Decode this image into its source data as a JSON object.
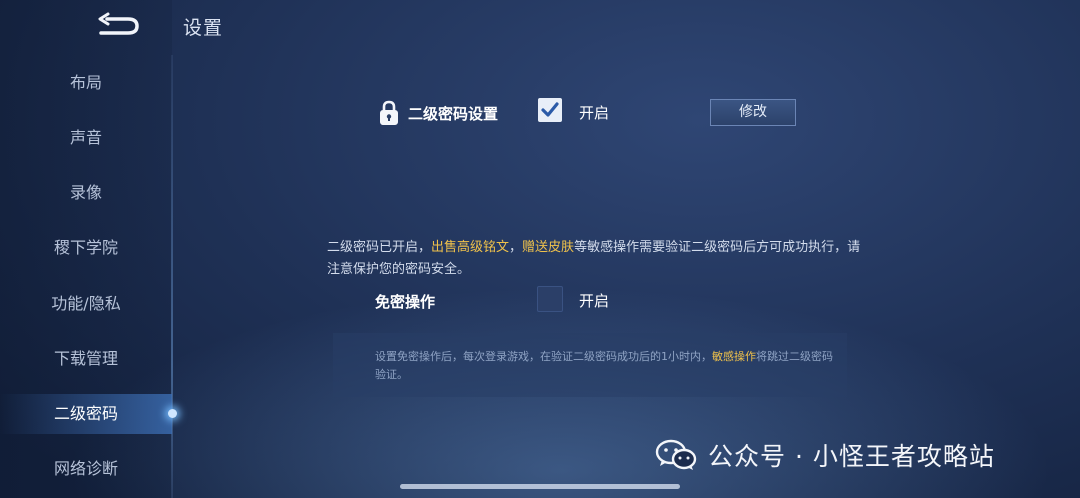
{
  "header": {
    "title": "设置",
    "back_icon": "back-arrow-icon"
  },
  "sidebar": {
    "items": [
      {
        "label": "布局",
        "active": false
      },
      {
        "label": "声音",
        "active": false
      },
      {
        "label": "录像",
        "active": false
      },
      {
        "label": "稷下学院",
        "active": false
      },
      {
        "label": "功能/隐私",
        "active": false
      },
      {
        "label": "下载管理",
        "active": false
      },
      {
        "label": "二级密码",
        "active": true
      },
      {
        "label": "网络诊断",
        "active": false
      }
    ]
  },
  "main": {
    "secondary_password": {
      "label": "二级密码设置",
      "icon": "lock-icon",
      "checkbox_checked": true,
      "checkbox_label": "开启",
      "modify_label": "修改"
    },
    "info": {
      "part1": "二级密码已开启，",
      "highlight1": "出售高级铭文",
      "part2": "，",
      "highlight2": "赠送皮肤",
      "part3": "等敏感操作需要验证二级密码后方可成功执行，请注意保护您的密码安全。"
    },
    "password_free": {
      "label": "免密操作",
      "checkbox_checked": false,
      "checkbox_label": "开启"
    },
    "note": {
      "part1": "设置免密操作后，每次登录游戏，在验证二级密码成功后的1小时内，",
      "highlight": "敏感操作",
      "part2": "将跳过二级密码验证。"
    }
  },
  "watermark": {
    "icon": "wechat-icon",
    "text": "公众号 · 小怪王者攻略站"
  },
  "colors": {
    "highlight": "#f0c24b",
    "background": "#1f3156",
    "active_nav": "#3c6eb4"
  }
}
